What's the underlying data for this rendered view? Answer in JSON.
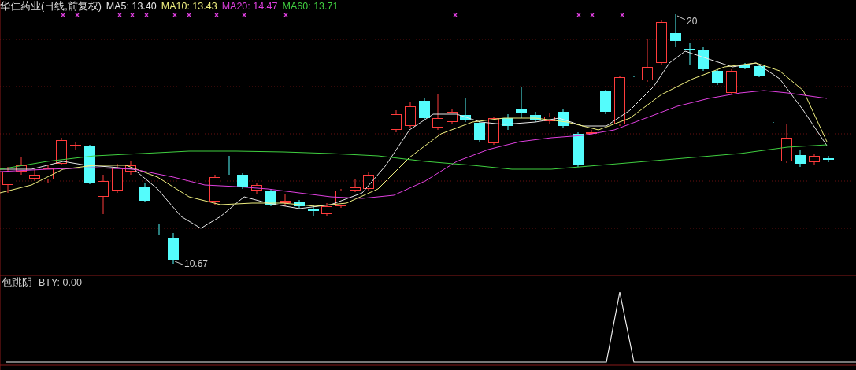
{
  "title": "华仁药业(日线,前复权)",
  "moving_averages": [
    {
      "label": "MA5: 13.40",
      "color": "#e8e8e8"
    },
    {
      "label": "MA10: 13.43",
      "color": "#f0f080"
    },
    {
      "label": "MA20: 14.47",
      "color": "#e040e0"
    },
    {
      "label": "MA60: 13.71",
      "color": "#40d040"
    }
  ],
  "price_chart": {
    "high_label": "20",
    "low_label": "10.67"
  },
  "indicator": {
    "name": "包跳阴",
    "reading": "BTY: 0.00"
  }
}
